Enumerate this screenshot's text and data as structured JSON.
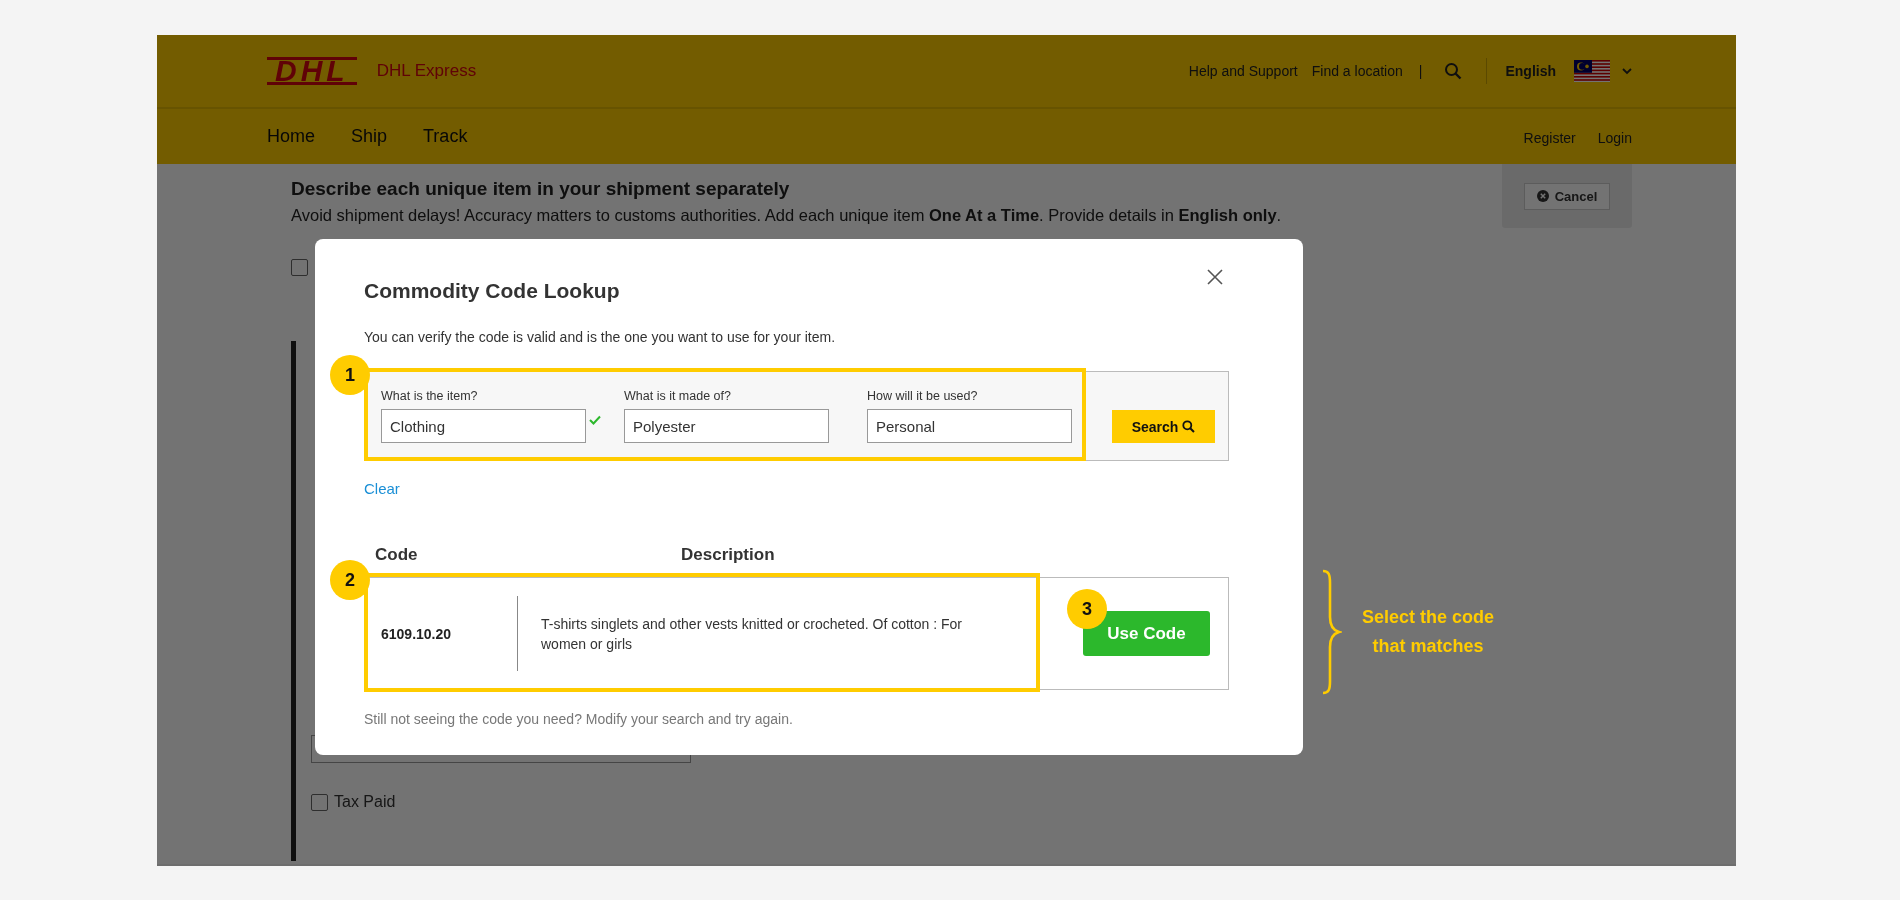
{
  "header": {
    "logo_text": "DHL",
    "brand": "DHL Express",
    "utility_links": [
      "Help and Support",
      "Find a location"
    ],
    "separator": "|",
    "language": "English",
    "nav": [
      "Home",
      "Ship",
      "Track"
    ],
    "account_links": [
      "Register",
      "Login"
    ]
  },
  "page": {
    "heading": "Describe each unique item in your shipment separately",
    "intro": "Avoid shipment delays! Accuracy matters to customs authorities.  Add each unique item **One At a Time**.  Provide details in **English only**.",
    "cancel_button": "Cancel",
    "top_checkbox": {
      "checked": false
    },
    "tax_paid": {
      "label": "Tax Paid",
      "checked": false
    }
  },
  "modal": {
    "title": "Commodity Code Lookup",
    "subtitle": "You can verify the code is valid and is the one you want to use for your item.",
    "fields": [
      {
        "label": "What is the item?",
        "value": "Clothing",
        "valid": true
      },
      {
        "label": "What is it made of?",
        "value": "Polyester",
        "valid": false
      },
      {
        "label": "How will it be used?",
        "value": "Personal",
        "valid": false
      }
    ],
    "search_button": "Search",
    "clear_link": "Clear",
    "columns": [
      "Code",
      "Description"
    ],
    "results": [
      {
        "code": "6109.10.20",
        "description": "T-shirts singlets and other vests knitted or crocheted. Of cotton : For women or girls",
        "button": "Use Code"
      }
    ],
    "footer": "Still not seeing the code you need? Modify your search and try again."
  },
  "annotations": {
    "badges": [
      "1",
      "2",
      "3"
    ],
    "note_lines": [
      "Select the code",
      "that matches"
    ]
  }
}
